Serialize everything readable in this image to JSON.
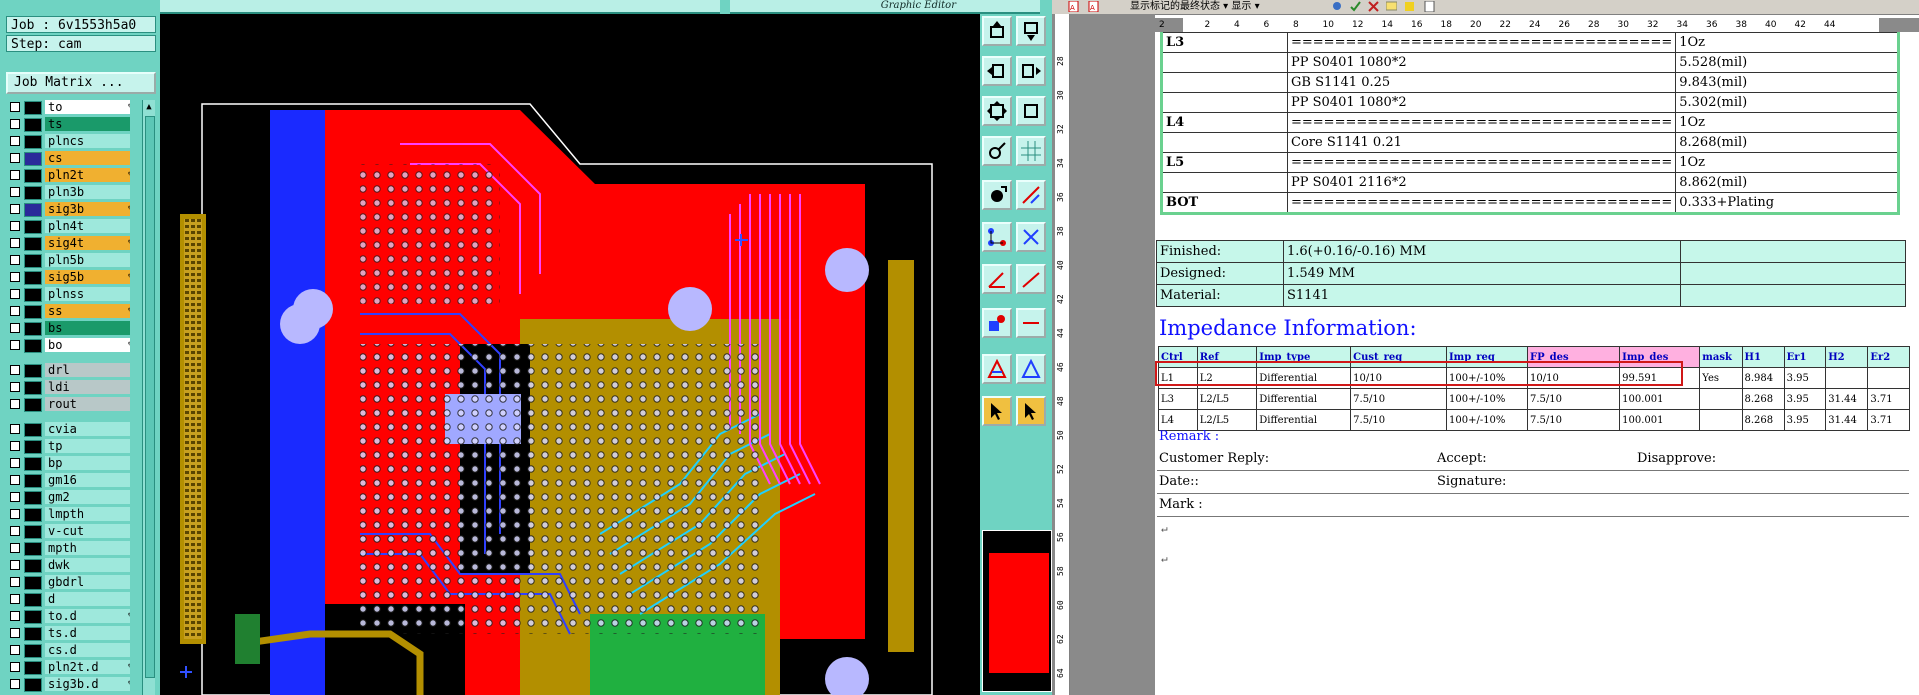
{
  "cam": {
    "title": "Graphic Editor",
    "job": "Job : 6v1553h5a0",
    "step": "Step: cam",
    "job_matrix": "Job Matrix ..."
  },
  "layers": [
    {
      "name": "to",
      "color": "#ffffff",
      "edit": true
    },
    {
      "name": "ts",
      "color": "#1a9a6a",
      "edit": false
    },
    {
      "name": "plncs",
      "color": "#9ee8dc",
      "edit": false
    },
    {
      "name": "cs",
      "color": "#f0b030",
      "edit": false,
      "box": true
    },
    {
      "name": "pln2t",
      "color": "#f0b030",
      "edit": true
    },
    {
      "name": "pln3b",
      "color": "#9ee8dc",
      "edit": false
    },
    {
      "name": "sig3b",
      "color": "#f0b030",
      "edit": true,
      "box": true
    },
    {
      "name": "pln4t",
      "color": "#9ee8dc",
      "edit": false
    },
    {
      "name": "sig4t",
      "color": "#f0b030",
      "edit": true
    },
    {
      "name": "pln5b",
      "color": "#9ee8dc",
      "edit": false
    },
    {
      "name": "sig5b",
      "color": "#f0b030",
      "edit": true
    },
    {
      "name": "plnss",
      "color": "#9ee8dc",
      "edit": false
    },
    {
      "name": "ss",
      "color": "#f0b030",
      "edit": true
    },
    {
      "name": "bs",
      "color": "#1a9a6a",
      "edit": false
    },
    {
      "name": "bo",
      "color": "#ffffff",
      "edit": true
    },
    {
      "name": "drl",
      "color": "#b8c8c8",
      "edit": false
    },
    {
      "name": "ldi",
      "color": "#b8c8c8",
      "edit": false
    },
    {
      "name": "rout",
      "color": "#b8c8c8",
      "edit": false
    },
    {
      "name": "cvia",
      "color": "#9ee8dc",
      "edit": false
    },
    {
      "name": "tp",
      "color": "#9ee8dc",
      "edit": false
    },
    {
      "name": "bp",
      "color": "#9ee8dc",
      "edit": false
    },
    {
      "name": "gm16",
      "color": "#9ee8dc",
      "edit": false
    },
    {
      "name": "gm2",
      "color": "#9ee8dc",
      "edit": false
    },
    {
      "name": "lmpth",
      "color": "#9ee8dc",
      "edit": false
    },
    {
      "name": "v-cut",
      "color": "#9ee8dc",
      "edit": false
    },
    {
      "name": "mpth",
      "color": "#9ee8dc",
      "edit": false
    },
    {
      "name": "dwk",
      "color": "#9ee8dc",
      "edit": false
    },
    {
      "name": "gbdrl",
      "color": "#9ee8dc",
      "edit": false
    },
    {
      "name": "d",
      "color": "#9ee8dc",
      "edit": false
    },
    {
      "name": "to.d",
      "color": "#9ee8dc",
      "edit": true
    },
    {
      "name": "ts.d",
      "color": "#9ee8dc",
      "edit": false
    },
    {
      "name": "cs.d",
      "color": "#9ee8dc",
      "edit": false
    },
    {
      "name": "pln2t.d",
      "color": "#9ee8dc",
      "edit": true
    },
    {
      "name": "sig3b.d",
      "color": "#9ee8dc",
      "edit": true
    }
  ],
  "word": {
    "style_box": "显示标记的最终状态",
    "show_label": "显示",
    "ruler": [
      "2",
      "2",
      "4",
      "6",
      "8",
      "10",
      "12",
      "14",
      "16",
      "18",
      "20",
      "22",
      "24",
      "26",
      "28",
      "30",
      "32",
      "34",
      "36",
      "38",
      "40",
      "42",
      "44"
    ],
    "vruler": [
      "28",
      "30",
      "32",
      "34",
      "36",
      "38",
      "40",
      "42",
      "44",
      "46",
      "48",
      "50",
      "52",
      "54",
      "56",
      "58",
      "60",
      "62",
      "64"
    ]
  },
  "stack": [
    {
      "layer": "L3",
      "desc": "===================================",
      "spec": "1Oz"
    },
    {
      "layer": "",
      "desc": "PP     S0401     1080*2",
      "spec": "5.528(mil)"
    },
    {
      "layer": "",
      "desc": "GB     S1141     0.25",
      "spec": "9.843(mil)"
    },
    {
      "layer": "",
      "desc": "PP     S0401     1080*2",
      "spec": "5.302(mil)"
    },
    {
      "layer": "L4",
      "desc": "===================================",
      "spec": "1Oz"
    },
    {
      "layer": "",
      "desc": "Core      S1141     0.21",
      "spec": "8.268(mil)"
    },
    {
      "layer": "L5",
      "desc": "===================================",
      "spec": "1Oz"
    },
    {
      "layer": "",
      "desc": "PP     S0401     2116*2",
      "spec": "8.862(mil)"
    },
    {
      "layer": "BOT",
      "desc": "===================================",
      "spec": "0.333+Plating"
    }
  ],
  "finish": [
    {
      "label": "Finished:",
      "value": "1.6(+0.16/-0.16) MM"
    },
    {
      "label": "Designed:",
      "value": "1.549 MM"
    },
    {
      "label": "Material:",
      "value": "S1141"
    }
  ],
  "impedance": {
    "title": "Impedance Information:",
    "headers": [
      "Ctrl",
      "Ref",
      "Imp_type",
      "Cust_req",
      "Imp_req",
      "FP_des",
      "Imp_des",
      "mask",
      "H1",
      "Er1",
      "H2",
      "Er2"
    ],
    "rows": [
      [
        "L1",
        "L2",
        "Differential",
        "10/10",
        "100+/-10%",
        "10/10",
        "99.591",
        "Yes",
        "8.984",
        "3.95",
        "",
        ""
      ],
      [
        "L3",
        "L2/L5",
        "Differential",
        "7.5/10",
        "100+/-10%",
        "7.5/10",
        "100.001",
        "",
        "8.268",
        "3.95",
        "31.44",
        "3.71"
      ],
      [
        "L4",
        "L2/L5",
        "Differential",
        "7.5/10",
        "100+/-10%",
        "7.5/10",
        "100.001",
        "",
        "8.268",
        "3.95",
        "31.44",
        "3.71"
      ]
    ]
  },
  "remarks": {
    "remark": "Remark :",
    "customer_reply": "Customer Reply:",
    "accept": "Accept:",
    "disapprove": "Disapprove:",
    "date": "Date::",
    "signature": "Signature:",
    "mark": "Mark :"
  }
}
